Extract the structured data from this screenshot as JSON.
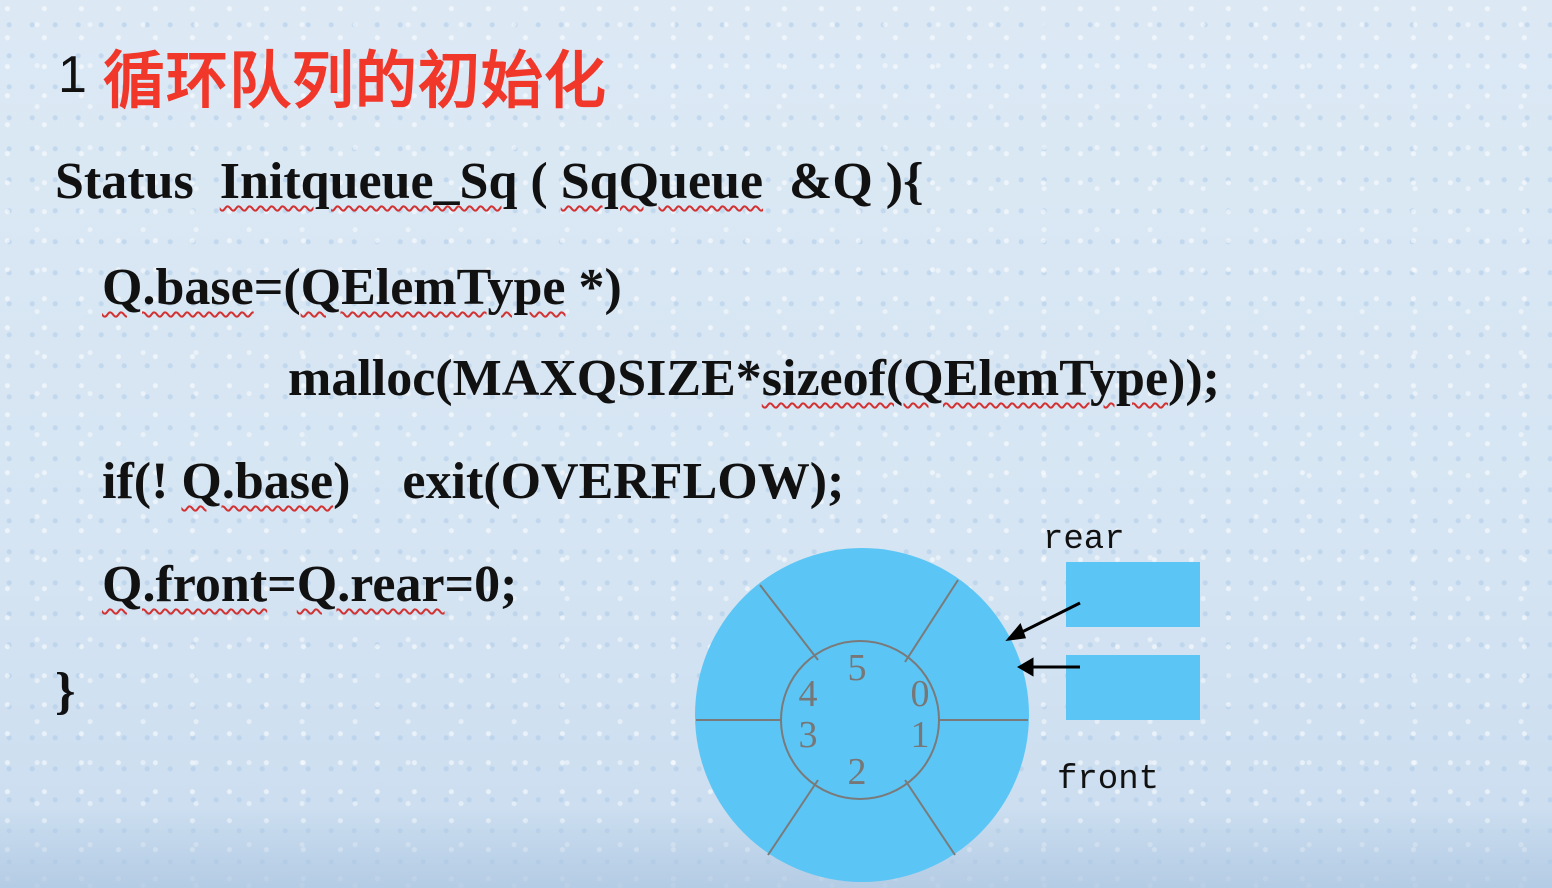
{
  "title": {
    "number": "1",
    "text": "循环队列的初始化"
  },
  "code": {
    "line1": {
      "p1": "Status  ",
      "p2": "Initqueue_Sq",
      "p3": " ( ",
      "p4": "SqQueue",
      "p5": "  &Q ){"
    },
    "line2": {
      "p1": "Q.base",
      "p2": "=(",
      "p3": "QElemType",
      "p4": " *)"
    },
    "line3": {
      "p1": "malloc(MAXQSIZE*",
      "p2": "sizeof(QElemType",
      "p3": "));"
    },
    "line4": {
      "p1": "if(! ",
      "p2": "Q.base",
      "p3": ")    exit(OVERFLOW);"
    },
    "line5": {
      "p1": "Q.front",
      "p2": "=",
      "p3": "Q.rear",
      "p4": "=0;"
    },
    "line6": "}"
  },
  "diagram": {
    "slot_labels": [
      "5",
      "0",
      "1",
      "2",
      "3",
      "4"
    ],
    "rear_label": "rear",
    "front_label": "front",
    "colors": {
      "fill": "#5bc6f5",
      "divider": "#7a7a7a",
      "text": "#777777",
      "arrow": "#000000"
    }
  }
}
